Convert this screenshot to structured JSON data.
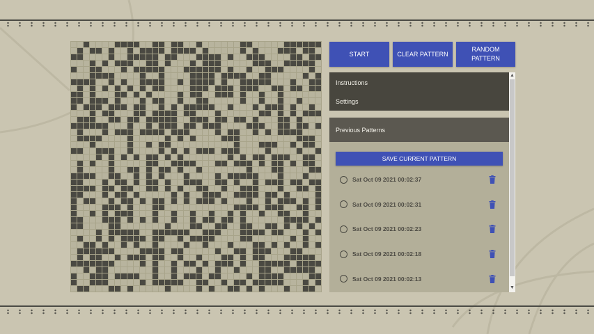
{
  "controls": {
    "start_label": "START",
    "clear_label": "CLEAR PATTERN",
    "random_label": "RANDOM PATTERN"
  },
  "accordion": {
    "instructions_label": "Instructions",
    "settings_label": "Settings",
    "previous_label": "Previous Patterns"
  },
  "previous_patterns": {
    "save_label": "SAVE CURRENT PATTERN",
    "items": [
      {
        "label": "Sat Oct 09 2021 00:02:37"
      },
      {
        "label": "Sat Oct 09 2021 00:02:31"
      },
      {
        "label": "Sat Oct 09 2021 00:02:23"
      },
      {
        "label": "Sat Oct 09 2021 00:02:18"
      },
      {
        "label": "Sat Oct 09 2021 00:02:13"
      }
    ]
  },
  "grid": {
    "cols": 40,
    "rows": 40,
    "seed": 2021
  },
  "icons": {
    "radio": "radio-unchecked-icon",
    "delete": "trash-icon",
    "scroll_up": "chevron-up-icon",
    "scroll_down": "chevron-down-icon"
  },
  "colors": {
    "background": "#cac5b1",
    "cell_alive": "#4a4942",
    "cell_dead": "#b8b49e",
    "accent": "#3f51b5",
    "panel_dark": "#48463e"
  }
}
